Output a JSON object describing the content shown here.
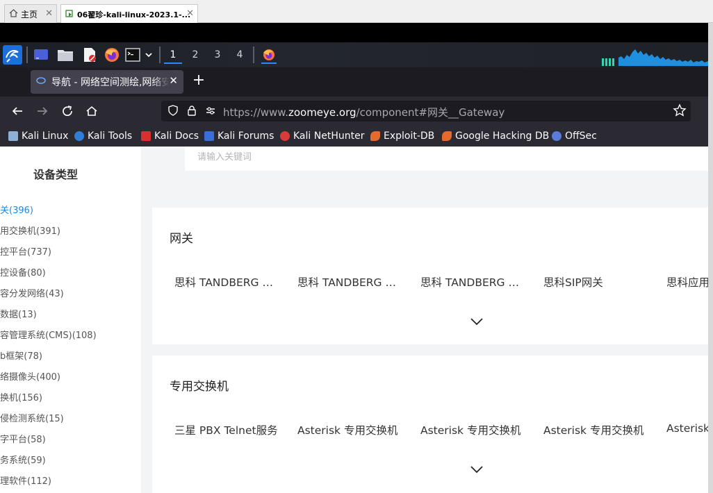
{
  "host_tabs": [
    {
      "label": "主页",
      "close": "✕"
    },
    {
      "label": "06翟珍-kali-linux-2023.1-...",
      "close": "✕"
    }
  ],
  "panel": {
    "workspaces": [
      "1",
      "2",
      "3",
      "4"
    ],
    "active_workspace": "1"
  },
  "browser": {
    "tab_title": "导航 - 网络空间测绘,网络安全",
    "tab_close": "✕",
    "new_tab": "+",
    "url_prefix": "https://www.",
    "url_domain": "zoomeye.org",
    "url_rest": "/component#网关__Gateway",
    "bookmarks": [
      {
        "label": "Kali Linux",
        "color": "#8fb0d6"
      },
      {
        "label": "Kali Tools",
        "color": "#2f7fd9"
      },
      {
        "label": "Kali Docs",
        "color": "#d92f2f"
      },
      {
        "label": "Kali Forums",
        "color": "#3b6ed9"
      },
      {
        "label": "Kali NetHunter",
        "color": "#d93a3a"
      },
      {
        "label": "Exploit-DB",
        "color": "#e46b2d"
      },
      {
        "label": "Google Hacking DB",
        "color": "#e46b2d"
      },
      {
        "label": "OffSec",
        "color": "#5a7bd9"
      }
    ]
  },
  "sidebar": {
    "title": "设备类型",
    "categories": [
      "关(396)",
      "用交换机(391)",
      "控平台(737)",
      "控设备(80)",
      "容分发网络(43)",
      "数据(13)",
      "容管理系统(CMS)(108)",
      "b框架(78)",
      "络摄像头(400)",
      "换机(156)",
      "侵检测系统(15)",
      "字平台(58)",
      "务系统(59)",
      "理软件(112)"
    ]
  },
  "search": {
    "placeholder": "请输入关键词"
  },
  "sections": [
    {
      "title": "网关",
      "items": [
        "思科 TANDBERG 网关",
        "思科 TANDBERG 网关",
        "思科 TANDBERG 网关",
        "思科SIP网关",
        "思科应用"
      ]
    },
    {
      "title": "专用交换机",
      "items": [
        "三星 PBX Telnet服务",
        "Asterisk 专用交换机",
        "Asterisk 专用交换机",
        "Asterisk 专用交换机",
        "Asterisk"
      ]
    }
  ]
}
